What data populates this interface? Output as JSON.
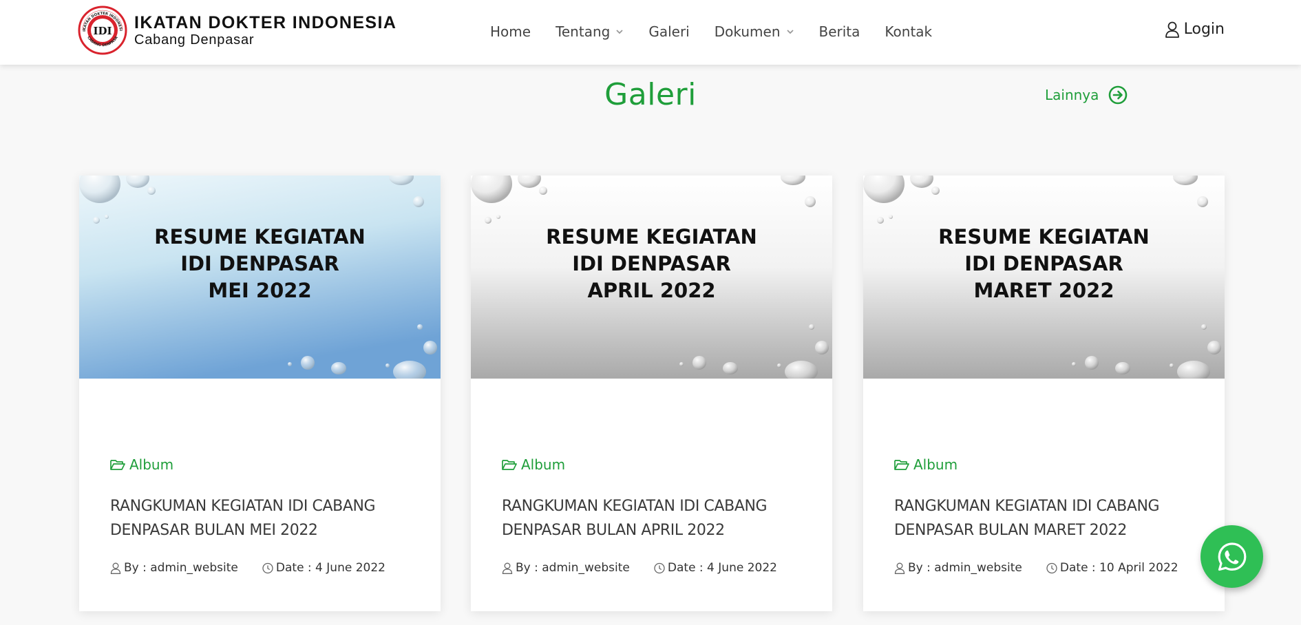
{
  "header": {
    "logo": {
      "title": "IKATAN DOKTER INDONESIA",
      "subtitle": "Cabang Denpasar",
      "seal_text_top": "IKATAN DOKTER INDONESIA",
      "seal_text_bottom": "CABANG DENPASAR"
    },
    "nav": [
      {
        "label": "Home",
        "dropdown": false
      },
      {
        "label": "Tentang",
        "dropdown": true
      },
      {
        "label": "Galeri",
        "dropdown": false
      },
      {
        "label": "Dokumen",
        "dropdown": true
      },
      {
        "label": "Berita",
        "dropdown": false
      },
      {
        "label": "Kontak",
        "dropdown": false
      }
    ],
    "login_label": "Login"
  },
  "section": {
    "title": "Galeri",
    "more_label": "Lainnya"
  },
  "cards": [
    {
      "thumb_lines": [
        "RESUME KEGIATAN",
        "IDI DENPASAR",
        "MEI 2022"
      ],
      "category": "Album",
      "title": "RANGKUMAN KEGIATAN IDI CABANG DENPASAR BULAN MEI 2022",
      "author": "By : admin_website",
      "date": "Date : 4 June 2022",
      "theme": "blue"
    },
    {
      "thumb_lines": [
        "RESUME KEGIATAN",
        "IDI DENPASAR",
        "APRIL 2022"
      ],
      "category": "Album",
      "title": "RANGKUMAN KEGIATAN IDI CABANG DENPASAR BULAN APRIL 2022",
      "author": "By : admin_website",
      "date": "Date : 4 June 2022",
      "theme": "gray"
    },
    {
      "thumb_lines": [
        "RESUME KEGIATAN",
        "IDI DENPASAR",
        "MARET 2022"
      ],
      "category": "Album",
      "title": "RANGKUMAN KEGIATAN IDI CABANG DENPASAR BULAN MARET 2022",
      "author": "By : admin_website",
      "date": "Date : 10 April 2022",
      "theme": "gray"
    }
  ],
  "colors": {
    "accent": "#1f9e3a",
    "whatsapp": "#2fbf55",
    "text": "#3a3a3a"
  },
  "icons": {
    "login": "user-icon",
    "more": "arrow-circle-right-icon",
    "category": "folder-open-icon",
    "author": "user-icon",
    "date": "clock-icon",
    "chat": "whatsapp-icon"
  }
}
